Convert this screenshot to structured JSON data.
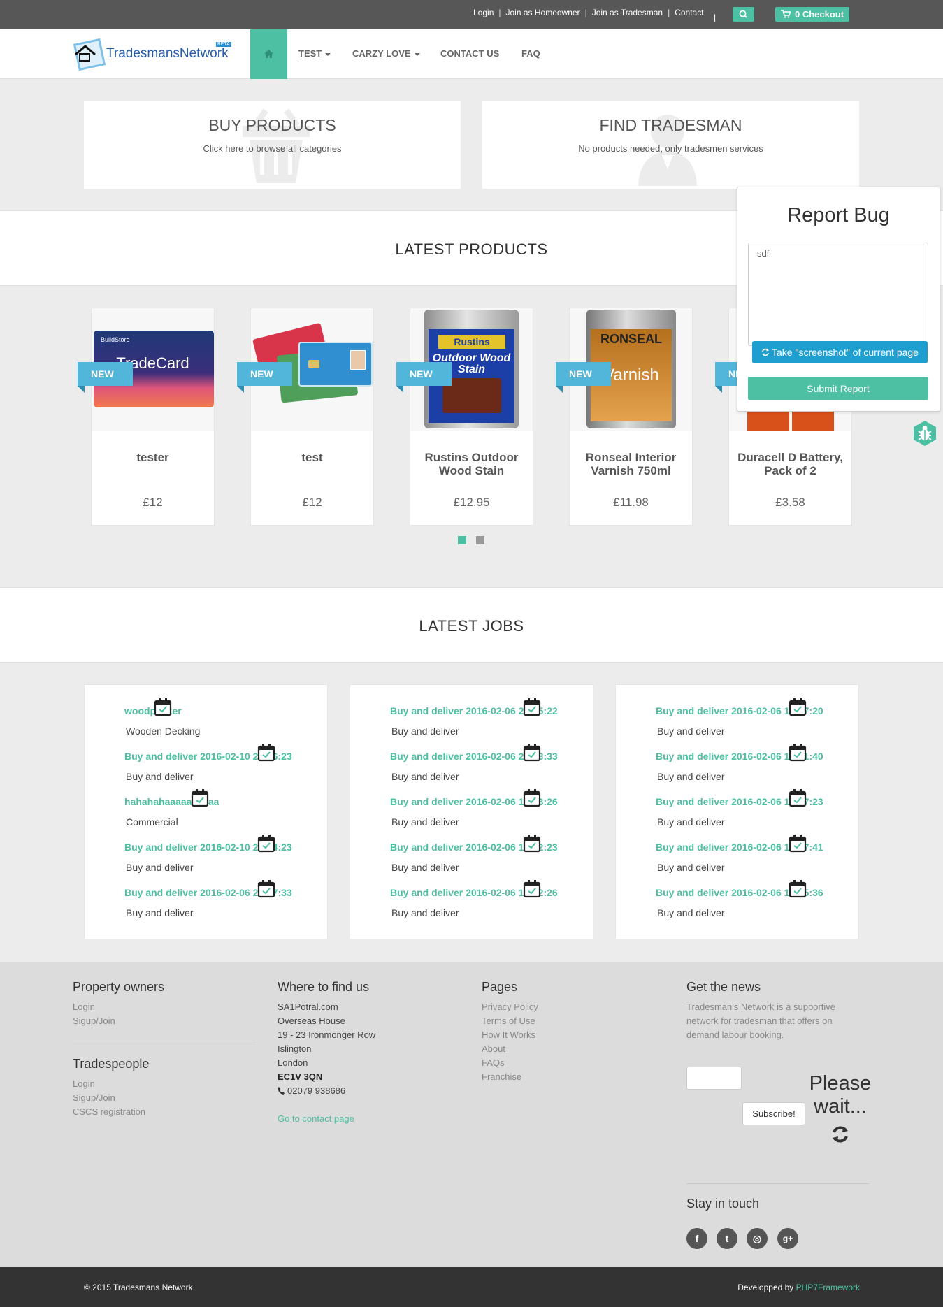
{
  "colors": {
    "accent": "#4dbfa2",
    "topbar": "#575757",
    "ribbon": "#52b6da",
    "screenshot_button": "#1e9fd0"
  },
  "topbar": {
    "links": [
      "Login",
      "Join as Homeowner",
      "Join as Tradesman",
      "Contact"
    ],
    "separator": "|",
    "pipe": "|",
    "search_icon": "search-icon",
    "cart_icon": "cart-icon",
    "checkout_label": "0 Checkout"
  },
  "brand": {
    "name": "TradesmansNetwork",
    "badge": "BETA"
  },
  "nav": {
    "home_icon": "home-icon",
    "items": [
      {
        "label": "TEST",
        "has_dropdown": true
      },
      {
        "label": "CARZY LOVE",
        "has_dropdown": true
      },
      {
        "label": "CONTACT US",
        "has_dropdown": false
      },
      {
        "label": "FAQ",
        "has_dropdown": false
      }
    ]
  },
  "features": [
    {
      "title": "BUY PRODUCTS",
      "subtitle": "Click here to browse all categories",
      "icon": "basket-icon"
    },
    {
      "title": "FIND TRADESMAN",
      "subtitle": "No products needed, only tradesmen services",
      "icon": "worker-icon"
    }
  ],
  "latest_products": {
    "heading": "LATEST PRODUCTS",
    "badge": "NEW",
    "items": [
      {
        "name": "tester",
        "price": "£12",
        "image": "tradecard-image"
      },
      {
        "name": "test",
        "price": "£12",
        "image": "id-cards-image"
      },
      {
        "name": "Rustins Outdoor Wood Stain",
        "price": "£12.95",
        "image": "rustins-tin-image"
      },
      {
        "name": "Ronseal Interior Varnish 750ml",
        "price": "£11.98",
        "image": "ronseal-tin-image"
      },
      {
        "name": "Duracell D Battery, Pack of 2",
        "price": "£3.58",
        "image": "duracell-image"
      }
    ],
    "pages": 2,
    "active_page": 1
  },
  "latest_jobs": {
    "heading": "LATEST JOBS",
    "columns": [
      [
        {
          "title": "woodpecker",
          "desc": "Wooden Decking"
        },
        {
          "title": "Buy and deliver 2016-02-10 22:56:23",
          "desc": "Buy and deliver"
        },
        {
          "title": "hahahahaaaaaaaaaa",
          "desc": "Commercial"
        },
        {
          "title": "Buy and deliver 2016-02-10 21:34:23",
          "desc": "Buy and deliver"
        },
        {
          "title": "Buy and deliver 2016-02-06 20:07:33",
          "desc": "Buy and deliver"
        }
      ],
      [
        {
          "title": "Buy and deliver 2016-02-06 20:05:22",
          "desc": "Buy and deliver"
        },
        {
          "title": "Buy and deliver 2016-02-06 20:03:33",
          "desc": "Buy and deliver"
        },
        {
          "title": "Buy and deliver 2016-02-06 19:43:26",
          "desc": "Buy and deliver"
        },
        {
          "title": "Buy and deliver 2016-02-06 19:42:23",
          "desc": "Buy and deliver"
        },
        {
          "title": "Buy and deliver 2016-02-06 19:42:26",
          "desc": "Buy and deliver"
        }
      ],
      [
        {
          "title": "Buy and deliver 2016-02-06 19:27:20",
          "desc": "Buy and deliver"
        },
        {
          "title": "Buy and deliver 2016-02-06 19:21:40",
          "desc": "Buy and deliver"
        },
        {
          "title": "Buy and deliver 2016-02-06 18:57:23",
          "desc": "Buy and deliver"
        },
        {
          "title": "Buy and deliver 2016-02-06 18:47:41",
          "desc": "Buy and deliver"
        },
        {
          "title": "Buy and deliver 2016-02-06 18:25:36",
          "desc": "Buy and deliver"
        }
      ]
    ]
  },
  "footer": {
    "property_owners": {
      "heading": "Property owners",
      "links": [
        "Login",
        "Sigup/Join"
      ]
    },
    "tradespeople": {
      "heading": "Tradespeople",
      "links": [
        "Login",
        "Sigup/Join",
        "CSCS registration"
      ]
    },
    "where": {
      "heading": "Where to find us",
      "lines": [
        "SA1Potral.com",
        "Overseas House",
        "19 - 23 Ironmonger Row",
        "Islington",
        "London"
      ],
      "postcode": "EC1V 3QN",
      "phone": "02079 938686",
      "contact_link": "Go to contact page"
    },
    "pages": {
      "heading": "Pages",
      "links": [
        "Privacy Policy",
        "Terms of Use",
        "How It Works",
        "About",
        "FAQs",
        "Franchise"
      ]
    },
    "news": {
      "heading": "Get the news",
      "text_lines": [
        "Tradesman's Network is a supportive",
        "network for tradesman that offers on",
        "demand labour booking."
      ],
      "email_value": "",
      "subscribe_label": "Subscribe!",
      "wait_line1": "Please",
      "wait_line2": "wait...",
      "stay_heading": "Stay in touch",
      "social": [
        "facebook-icon",
        "twitter-icon",
        "instagram-icon",
        "google-plus-icon"
      ],
      "social_glyphs": [
        "f",
        "t",
        "◎",
        "g+"
      ]
    }
  },
  "bottom": {
    "copyright": "© 2015 Tradesmans Network.",
    "dev_prefix": "Developped by ",
    "dev_link": "PHP7Framework"
  },
  "bug_report": {
    "title": "Report Bug",
    "text": "sdf",
    "screenshot_label": "Take \"screenshot\" of current page",
    "submit_label": "Submit Report"
  }
}
